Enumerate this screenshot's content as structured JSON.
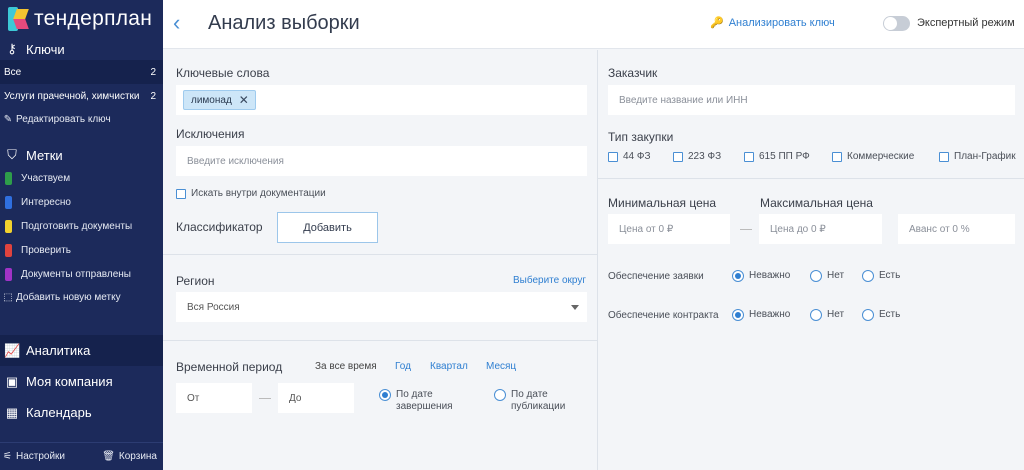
{
  "sidebar": {
    "logo_text": "тендерплан",
    "keys_heading": "Ключи",
    "keys": [
      {
        "label": "Все",
        "count": "2"
      },
      {
        "label": "Услуги прачечной, химчистки",
        "count": "2"
      }
    ],
    "edit_key": "Редактировать ключ",
    "tags_heading": "Метки",
    "tags": [
      {
        "label": "Участвуем",
        "color": "#2e9d4a"
      },
      {
        "label": "Интересно",
        "color": "#2f6fe0"
      },
      {
        "label": "Подготовить документы",
        "color": "#f2d22e"
      },
      {
        "label": "Проверить",
        "color": "#e0433e"
      },
      {
        "label": "Документы отправлены",
        "color": "#a033c7"
      }
    ],
    "add_tag": "Добавить новую метку",
    "nav": [
      {
        "label": "Аналитика",
        "icon": "chart-icon"
      },
      {
        "label": "Моя компания",
        "icon": "briefcase-icon"
      },
      {
        "label": "Календарь",
        "icon": "calendar-icon"
      }
    ],
    "settings": "Настройки",
    "trash": "Корзина"
  },
  "header": {
    "title": "Анализ выборки",
    "analyze_key": "Анализировать ключ",
    "expert_mode": "Экспертный режим"
  },
  "left": {
    "keywords_label": "Ключевые слова",
    "keyword_chip": "лимонад",
    "exclusions_label": "Исключения",
    "exclusions_placeholder": "Введите исключения",
    "search_in_docs": "Искать внутри документации",
    "classifier_label": "Классификатор",
    "add_button": "Добавить",
    "region_label": "Регион",
    "choose_district": "Выберите округ",
    "region_value": "Вся Россия",
    "period_label": "Временной период",
    "period_options": [
      "За все время",
      "Год",
      "Квартал",
      "Месяц"
    ],
    "from_placeholder": "От",
    "to_placeholder": "До",
    "by_end_date": [
      "По дате",
      "завершения"
    ],
    "by_pub_date": [
      "По дате",
      "публикации"
    ]
  },
  "right": {
    "customer_label": "Заказчик",
    "customer_placeholder": "Введите название или ИНН",
    "purchase_type_label": "Тип закупки",
    "purchase_types": [
      "44 ФЗ",
      "223 ФЗ",
      "615 ПП РФ",
      "Коммерческие",
      "План-График"
    ],
    "min_price_label": "Минимальная цена",
    "max_price_label": "Максимальная цена",
    "min_price_placeholder": "Цена от 0 ₽",
    "max_price_placeholder": "Цена до 0 ₽",
    "advance_placeholder": "Аванс от 0 %",
    "bid_security_label": "Обеспечение заявки",
    "contract_security_label": "Обеспечение контракта",
    "security_options": [
      "Неважно",
      "Нет",
      "Есть"
    ]
  }
}
